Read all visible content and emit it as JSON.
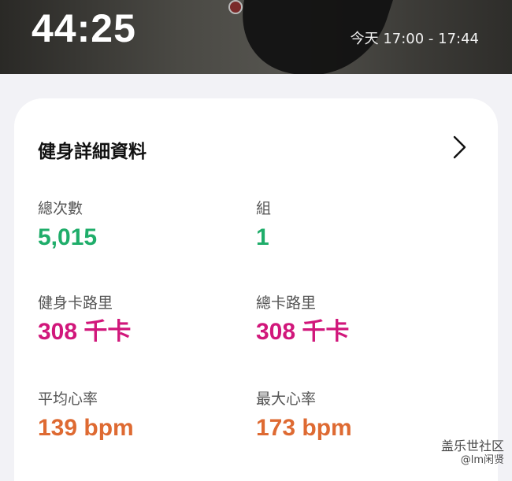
{
  "header": {
    "duration": "44:25",
    "time_range": "今天 17:00 - 17:44"
  },
  "card": {
    "title": "健身詳細資料",
    "chevron_icon": "chevron-right-icon",
    "stats": [
      {
        "label": "總次數",
        "value": "5,015",
        "color": "#1fad6a"
      },
      {
        "label": "組",
        "value": "1",
        "color": "#1fad6a"
      },
      {
        "label": "健身卡路里",
        "value": "308 千卡",
        "color": "#d1177b"
      },
      {
        "label": "總卡路里",
        "value": "308 千卡",
        "color": "#d1177b"
      },
      {
        "label": "平均心率",
        "value": "139 bpm",
        "color": "#de6a32"
      },
      {
        "label": "最大心率",
        "value": "173 bpm",
        "color": "#de6a32"
      }
    ]
  },
  "watermark": {
    "line1": "盖乐世社区",
    "line2": "@lm闲贤"
  }
}
